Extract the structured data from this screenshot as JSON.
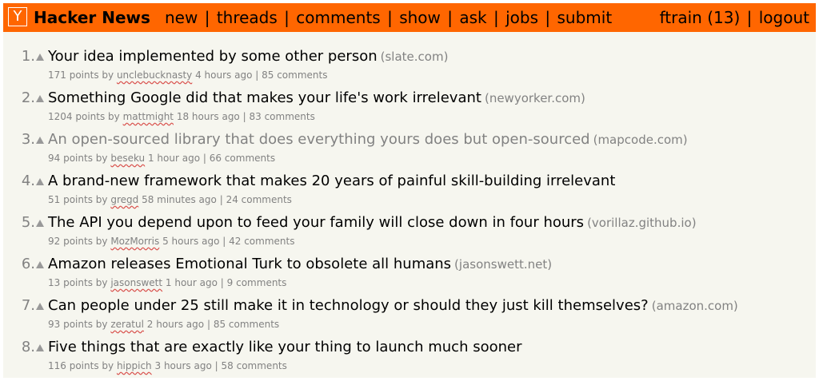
{
  "header": {
    "logo": "Y",
    "site_name": "Hacker News",
    "nav": [
      "new",
      "threads",
      "comments",
      "show",
      "ask",
      "jobs",
      "submit"
    ],
    "separator": "|",
    "username": "ftrain",
    "karma": "(13)",
    "logout": "logout"
  },
  "colors": {
    "accent": "#ff6600",
    "background": "#f6f6ef",
    "subtext": "#828282"
  },
  "stories": [
    {
      "rank": "1.",
      "title": "Your idea implemented by some other person",
      "site": "(slate.com)",
      "points": "171 points",
      "by": "by",
      "user": "unclebucknasty",
      "age": "4 hours ago",
      "comments": "85 comments",
      "visited": false
    },
    {
      "rank": "2.",
      "title": "Something Google did that makes your life's work irrelevant",
      "site": "(newyorker.com)",
      "points": "1204 points",
      "by": "by",
      "user": "mattmight",
      "age": "18 hours ago",
      "comments": "83 comments",
      "visited": false
    },
    {
      "rank": "3.",
      "title": "An open-sourced library that does everything yours does but open-sourced",
      "site": "(mapcode.com)",
      "points": "94 points",
      "by": "by",
      "user": "beseku",
      "age": "1 hour ago",
      "comments": "66 comments",
      "visited": true
    },
    {
      "rank": "4.",
      "title": "A brand-new framework that makes 20 years of painful skill-building irrelevant",
      "site": "",
      "points": "51 points",
      "by": "by",
      "user": "gregd",
      "age": "58 minutes ago",
      "comments": "24 comments",
      "visited": false
    },
    {
      "rank": "5.",
      "title": "The API you depend upon to feed your family will close down in four hours",
      "site": "(vorillaz.github.io)",
      "points": "92 points",
      "by": "by",
      "user": "MozMorris",
      "age": "5 hours ago",
      "comments": "42 comments",
      "visited": false
    },
    {
      "rank": "6.",
      "title": "Amazon releases Emotional Turk to obsolete all humans",
      "site": "(jasonswett.net)",
      "points": "13 points",
      "by": "by",
      "user": "jasonswett",
      "age": "1 hour ago",
      "comments": "9 comments",
      "visited": false
    },
    {
      "rank": "7.",
      "title": "Can people under 25 still make it in technology or should they just kill themselves?",
      "site": "(amazon.com)",
      "points": "93 points",
      "by": "by",
      "user": "zeratul",
      "age": "2 hours ago",
      "comments": "85 comments",
      "visited": false
    },
    {
      "rank": "8.",
      "title": "Five things that are exactly like your thing to launch much sooner",
      "site": "",
      "points": "116 points",
      "by": "by",
      "user": "hippich",
      "age": "3 hours ago",
      "comments": "58 comments",
      "visited": false
    }
  ]
}
